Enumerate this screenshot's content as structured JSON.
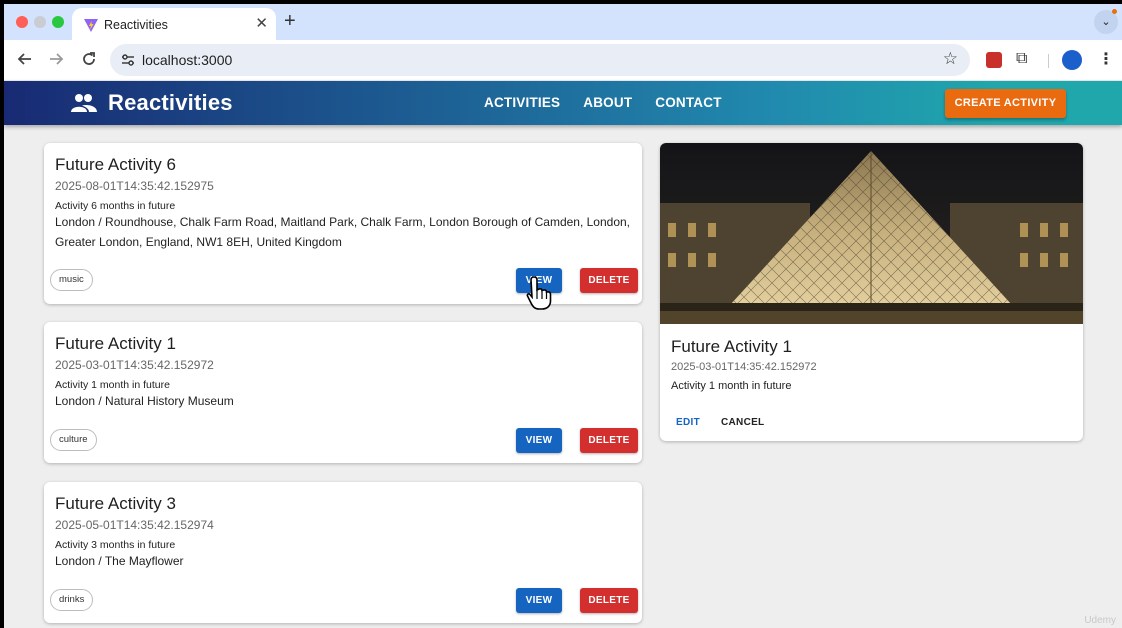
{
  "browser": {
    "tab_title": "Reactivities",
    "tab_close": "✕",
    "new_tab": "+",
    "tabs_menu": "⌄",
    "url": "localhost:3000",
    "star_icon": "☆",
    "puzzle_icon": "⧉",
    "kebab": "⋮"
  },
  "navbar": {
    "brand": "Reactivities",
    "links": [
      "ACTIVITIES",
      "ABOUT",
      "CONTACT"
    ],
    "create_button": "CREATE ACTIVITY",
    "gradient": [
      "#182a73",
      "#218aae",
      "#20a7ac"
    ],
    "accent": "#ea6a10"
  },
  "activities": [
    {
      "title": "Future Activity 6",
      "date": "2025-08-01T14:35:42.152975",
      "description": "Activity 6 months in future",
      "venue": "London / Roundhouse, Chalk Farm Road, Maitland Park, Chalk Farm, London Borough of Camden, London, Greater London, England, NW1 8EH, United Kingdom",
      "category": "music",
      "view_label": "VIEW",
      "delete_label": "DELETE"
    },
    {
      "title": "Future Activity 1",
      "date": "2025-03-01T14:35:42.152972",
      "description": "Activity 1 month in future",
      "venue": "London / Natural History Museum",
      "category": "culture",
      "view_label": "VIEW",
      "delete_label": "DELETE"
    },
    {
      "title": "Future Activity 3",
      "date": "2025-05-01T14:35:42.152974",
      "description": "Activity 3 months in future",
      "venue": "London / The Mayflower",
      "category": "drinks",
      "view_label": "VIEW",
      "delete_label": "DELETE"
    }
  ],
  "detail": {
    "title": "Future Activity 1",
    "date": "2025-03-01T14:35:42.152972",
    "description": "Activity 1 month in future",
    "edit_label": "EDIT",
    "cancel_label": "CANCEL"
  },
  "watermark": "Udemy",
  "colors": {
    "primary": "#1565c0",
    "danger": "#d32f2f"
  }
}
